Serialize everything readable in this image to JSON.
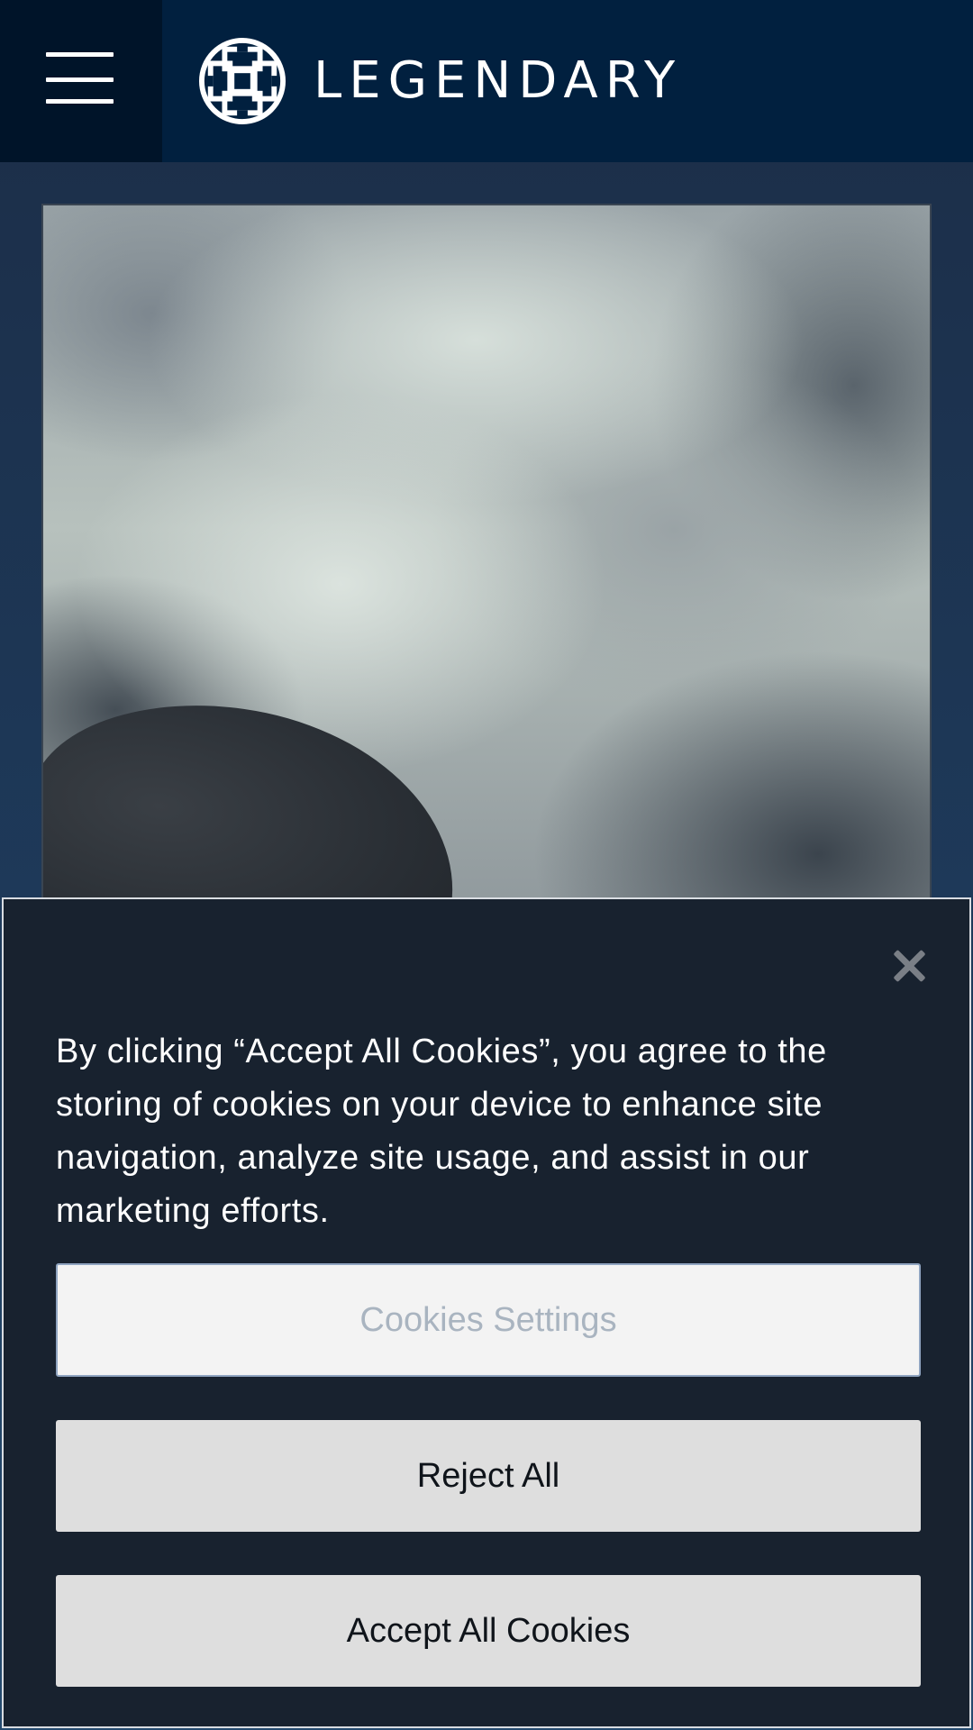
{
  "header": {
    "menu_icon": "hamburger-menu-icon",
    "logo_icon": "celtic-knot-logo-icon",
    "brand_name": "LEGENDARY",
    "background_color": "#01203f",
    "menu_background_color": "#001429"
  },
  "hero": {
    "image_description_icon": "hero-image"
  },
  "cookie_banner": {
    "message": "By clicking “Accept All Cookies”, you agree to the storing of cookies on your device to enhance site navigation, analyze site usage, and assist in our marketing efforts.",
    "close_icon": "close-icon",
    "settings_label": "Cookies Settings",
    "reject_label": "Reject All",
    "accept_label": "Accept All Cookies",
    "background_color": "#18222f"
  }
}
